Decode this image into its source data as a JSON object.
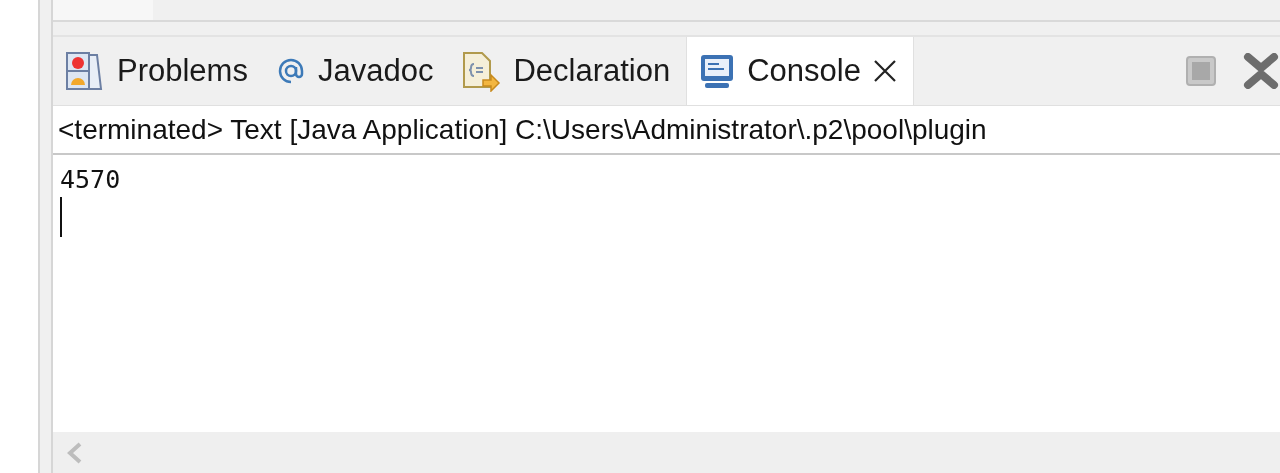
{
  "tabs": [
    {
      "label": "Problems",
      "selected": false
    },
    {
      "label": "Javadoc",
      "selected": false
    },
    {
      "label": "Declaration",
      "selected": false
    },
    {
      "label": "Console",
      "selected": true
    }
  ],
  "console": {
    "header": "<terminated> Text [Java Application] C:\\Users\\Administrator\\.p2\\pool\\plugin",
    "output": [
      "4570"
    ]
  }
}
